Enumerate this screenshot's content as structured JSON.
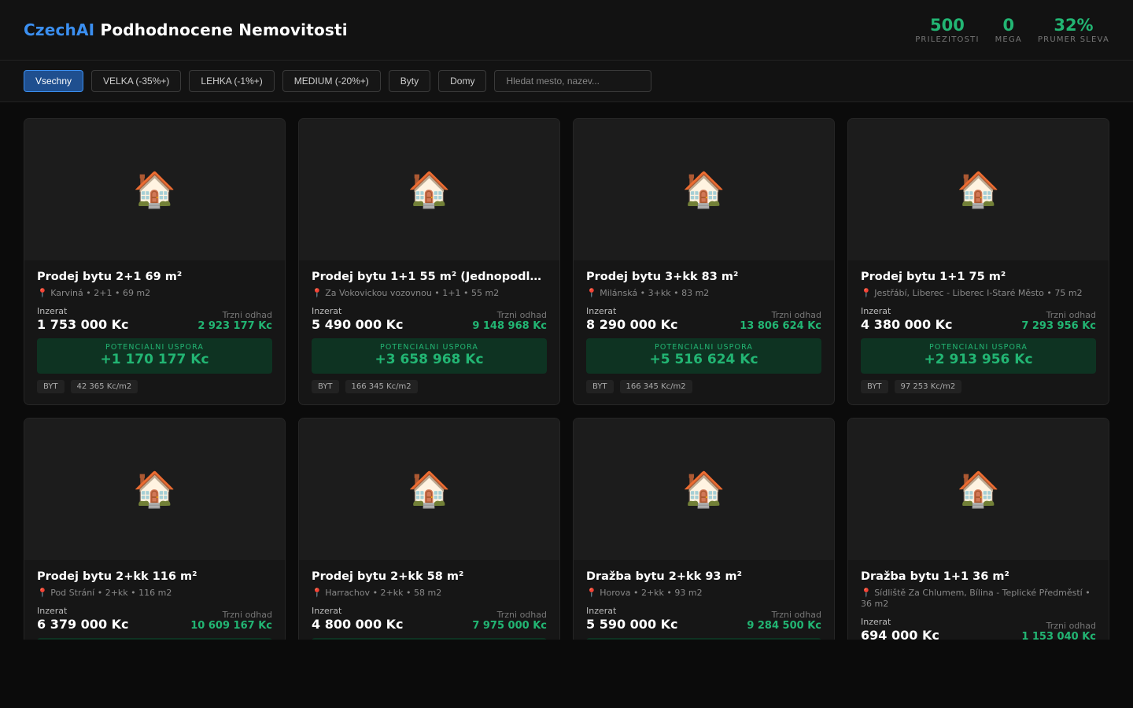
{
  "header": {
    "brand_accent": "CzechAI",
    "brand_title": "Podhodnocene Nemovitosti",
    "stats": [
      {
        "value": "500",
        "label": "PRILEZITOSTI"
      },
      {
        "value": "0",
        "label": "MEGA"
      },
      {
        "value": "32%",
        "label": "PRUMER SLEVA"
      }
    ]
  },
  "filters": {
    "buttons": [
      "Vsechny",
      "VELKA (-35%+)",
      "LEHKA (-1%+)",
      "MEDIUM (-20%+)",
      "Byty",
      "Domy"
    ],
    "active": "Vsechny",
    "search_placeholder": "Hledat mesto, nazev..."
  },
  "labels": {
    "listing_price": "Inzerat",
    "market_estimate": "Trzni odhad",
    "savings": "POTENCIALNI USPORA",
    "pin_icon": "📍",
    "house_icon": "🏠"
  },
  "colors": {
    "accent": "#3b8ff0",
    "green": "#22b573",
    "savings_bg": "#0e3322"
  },
  "cards": [
    {
      "title": "Prodej bytu 2+1 69 m²",
      "location": "Karviná • 2+1 • 69 m2",
      "price": "1 753 000 Kc",
      "market": "2 923 177 Kc",
      "savings": "+1 170 177 Kc",
      "type": "BYT",
      "ppm": "42 365 Kc/m2"
    },
    {
      "title": "Prodej bytu 1+1 55 m² (Jednopodla…",
      "location": "Za Vokovickou vozovnou • 1+1 • 55 m2",
      "price": "5 490 000 Kc",
      "market": "9 148 968 Kc",
      "savings": "+3 658 968 Kc",
      "type": "BYT",
      "ppm": "166 345 Kc/m2"
    },
    {
      "title": "Prodej bytu 3+kk 83 m²",
      "location": "Milánská • 3+kk • 83 m2",
      "price": "8 290 000 Kc",
      "market": "13 806 624 Kc",
      "savings": "+5 516 624 Kc",
      "type": "BYT",
      "ppm": "166 345 Kc/m2"
    },
    {
      "title": "Prodej bytu 1+1 75 m²",
      "location": "Jestřábí, Liberec - Liberec I-Staré Město • 75 m2",
      "price": "4 380 000 Kc",
      "market": "7 293 956 Kc",
      "savings": "+2 913 956 Kc",
      "type": "BYT",
      "ppm": "97 253 Kc/m2"
    },
    {
      "title": "Prodej bytu 2+kk 116 m²",
      "location": "Pod Strání • 2+kk • 116 m2",
      "price": "6 379 000 Kc",
      "market": "10 609 167 Kc",
      "savings": "",
      "type": "",
      "ppm": ""
    },
    {
      "title": "Prodej bytu 2+kk 58 m²",
      "location": "Harrachov • 2+kk • 58 m2",
      "price": "4 800 000 Kc",
      "market": "7 975 000 Kc",
      "savings": "",
      "type": "",
      "ppm": ""
    },
    {
      "title": "Dražba bytu 2+kk 93 m²",
      "location": "Horova • 2+kk • 93 m2",
      "price": "5 590 000 Kc",
      "market": "9 284 500 Kc",
      "savings": "",
      "type": "",
      "ppm": ""
    },
    {
      "title": "Dražba bytu 1+1 36 m²",
      "location": "Sídliště Za Chlumem, Bílina - Teplické Předměstí • 36 m2",
      "price": "694 000 Kc",
      "market": "1 153 040 Kc",
      "savings": "",
      "type": "",
      "ppm": ""
    }
  ]
}
